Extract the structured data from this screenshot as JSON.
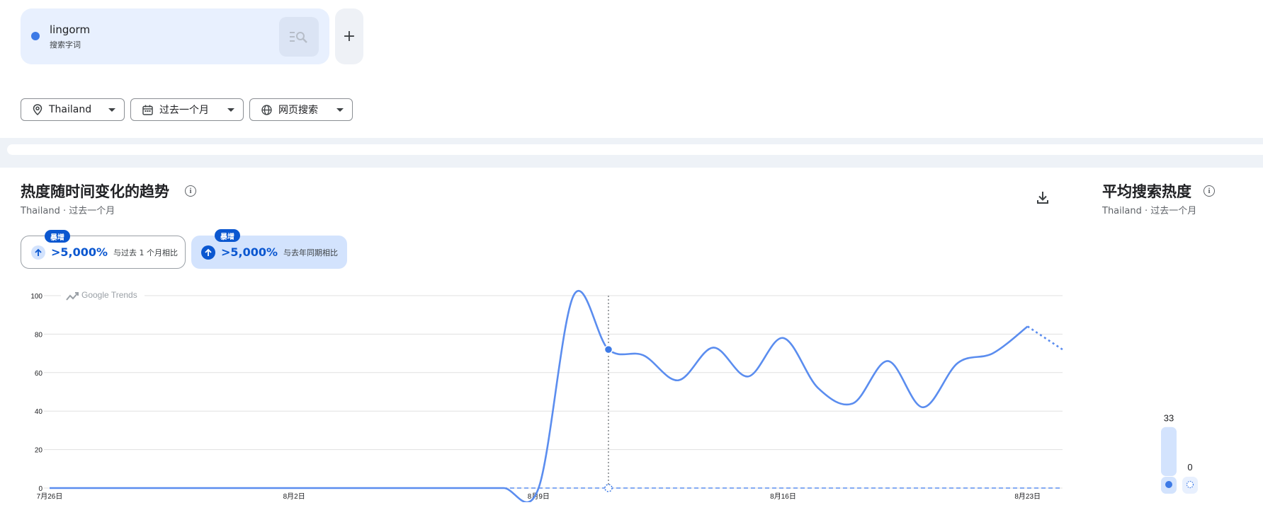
{
  "term": {
    "name": "lingorm",
    "type": "搜索字词",
    "color": "#3d7ae6",
    "action_icon": "search-filter-icon"
  },
  "add_button": {
    "label": "+",
    "icon": "plus-icon"
  },
  "filters": {
    "geo": {
      "label": "Thailand",
      "icon": "location-pin-icon"
    },
    "time": {
      "label": "过去一个月",
      "icon": "calendar-icon"
    },
    "property": {
      "label": "网页搜索",
      "icon": "globe-icon"
    }
  },
  "trend_section": {
    "title": "热度随时间变化的趋势",
    "subtitle": "Thailand · 过去一个月",
    "download_icon": "download-icon",
    "chips": [
      {
        "badge": "暴增",
        "value": ">5,000%",
        "label": "与过去 1 个月相比",
        "icon": "arrow-up-icon",
        "selected": false
      },
      {
        "badge": "暴增",
        "value": ">5,000%",
        "label": "与去年同期相比",
        "icon": "arrow-up-icon",
        "selected": true
      }
    ],
    "watermark": "Google Trends"
  },
  "avg_section": {
    "title": "平均搜索热度",
    "subtitle": "Thailand · 过去一个月"
  },
  "chart_data": [
    {
      "type": "line",
      "title": "热度随时间变化的趋势",
      "x": [
        "7月26日",
        "7月27日",
        "7月28日",
        "7月29日",
        "7月30日",
        "7月31日",
        "8月1日",
        "8月2日",
        "8月3日",
        "8月4日",
        "8月5日",
        "8月6日",
        "8月7日",
        "8月8日",
        "8月9日",
        "8月10日",
        "8月11日",
        "8月12日",
        "8月13日",
        "8月14日",
        "8月15日",
        "8月16日",
        "8月17日",
        "8月18日",
        "8月19日",
        "8月20日",
        "8月21日",
        "8月22日",
        "8月23日",
        "8月24日"
      ],
      "x_tick_labels": [
        "7月26日",
        "8月2日",
        "8月9日",
        "8月16日",
        "8月23日"
      ],
      "series": [
        {
          "color": "#5b8def",
          "values": [
            0,
            0,
            0,
            0,
            0,
            0,
            0,
            0,
            0,
            0,
            0,
            0,
            0,
            0,
            0,
            100,
            72,
            69,
            56,
            73,
            58,
            78,
            52,
            44,
            66,
            42,
            65,
            70,
            84,
            72
          ],
          "partial_from_index": 28,
          "style": "solid"
        },
        {
          "color": "#5b8def",
          "values": [
            0,
            0,
            0,
            0,
            0,
            0,
            0,
            0,
            0,
            0,
            0,
            0,
            0,
            0,
            0,
            0,
            0,
            0,
            0,
            0,
            0,
            0,
            0,
            0,
            0,
            0,
            0,
            0,
            0,
            0
          ],
          "style": "dashed"
        }
      ],
      "highlight_index": 16,
      "ylim": [
        0,
        100
      ],
      "y_ticks": [
        0,
        20,
        40,
        60,
        80,
        100
      ],
      "grid": true
    },
    {
      "type": "bar",
      "title": "平均搜索热度",
      "values": [
        33,
        0
      ],
      "value_labels": [
        "33",
        "0"
      ],
      "colors": [
        "#d3e3fd",
        "#e8f0fe"
      ],
      "ylim": [
        0,
        100
      ]
    }
  ]
}
